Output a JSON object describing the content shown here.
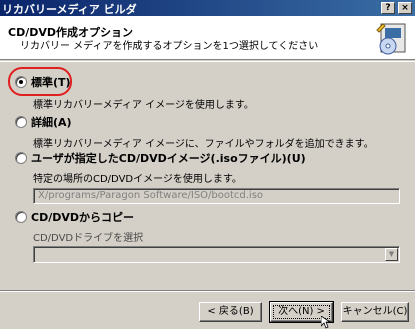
{
  "window": {
    "title": "リカバリーメディア ビルダ",
    "help_button": "?",
    "close_button": "×"
  },
  "header": {
    "title": "CD/DVD作成オプション",
    "subtitle": "リカバリー メディアを作成するオプションを1つ選択してください"
  },
  "options": [
    {
      "label": "標準(T)",
      "description": "標準リカバリーメディア イメージを使用します。",
      "checked": true
    },
    {
      "label": "詳細(A)",
      "description": "標準リカバリーメディア イメージに、ファイルやフォルダを追加できます。",
      "checked": false
    },
    {
      "label": "ユーザが指定したCD/DVDイメージ(.isoファイル)(U)",
      "description": "特定の場所のCD/DVDイメージを使用します。",
      "path_value": "X/programs/Paragon Software/ISO/bootcd.iso",
      "checked": false
    },
    {
      "label": "CD/DVDからコピー",
      "description": "CD/DVDドライブを選択",
      "drive_value": "",
      "checked": false
    }
  ],
  "buttons": {
    "back": "< 戻る(B)",
    "next": "次へ(N) >",
    "cancel": "キャンセル(C)"
  },
  "colors": {
    "titlebar_start": "#0a246a",
    "titlebar_end": "#3a6ea5",
    "highlight_ring": "#e0201e",
    "dialog_face": "#d4d0c8"
  },
  "icons": {
    "header": "wizard-cd-icon",
    "combo": "dropdown-arrow-icon",
    "cursor": "mouse-pointer-icon"
  }
}
